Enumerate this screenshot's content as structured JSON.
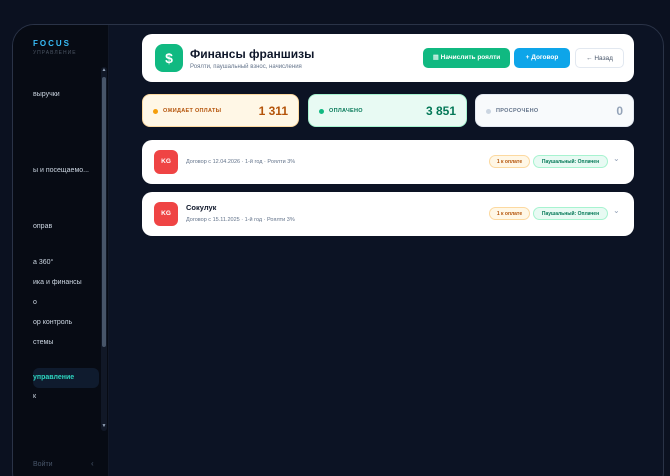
{
  "sidebar": {
    "brand_title": "FOCUS",
    "brand_sub": "УПРАВЛЕНИЕ",
    "items": [
      {
        "label": "выручки"
      },
      {
        "label": "ы и посещаемо..."
      },
      {
        "label": "оправ"
      },
      {
        "label": "а 360°"
      },
      {
        "label": "ика и финансы"
      },
      {
        "label": "о"
      },
      {
        "label": "ор контроль"
      },
      {
        "label": "стемы"
      },
      {
        "label": "управление",
        "active": true
      },
      {
        "label": "к"
      }
    ],
    "logout_label": "Войти",
    "collapse_icon": "‹"
  },
  "header": {
    "title": "Финансы франшизы",
    "subtitle": "Роялти, паушальный взнос, начисления",
    "icon_glyph": "$",
    "btn_royalty": "Начислить роялти",
    "btn_contract": "Договор",
    "btn_back": "Назад"
  },
  "stats": {
    "pending": {
      "label": "ОЖИДАЕТ ОПЛАТЫ",
      "value": "1 311"
    },
    "paid": {
      "label": "ОПЛАЧЕНО",
      "value": "3 851"
    },
    "overdue": {
      "label": "ПРОСРОЧЕНО",
      "value": "0"
    }
  },
  "contracts": [
    {
      "flag": "KG",
      "name": "",
      "meta": "Договор с 12.04.2026 · 1-й год · Роялти 3%",
      "badge_pay": "1 к оплате",
      "badge_lump": "Паушальный: Оплачен"
    },
    {
      "flag": "KG",
      "name": "Сокулук",
      "meta": "Договор с 15.11.2025 · 1-й год · Роялти 3%",
      "badge_pay": "1 к оплате",
      "badge_lump": "Паушальный: Оплачен"
    }
  ],
  "colors": {
    "accent_green": "#10b981",
    "accent_blue": "#0ea5e9",
    "flag_red": "#ef4444",
    "sidebar_active": "#2dd4bf"
  }
}
